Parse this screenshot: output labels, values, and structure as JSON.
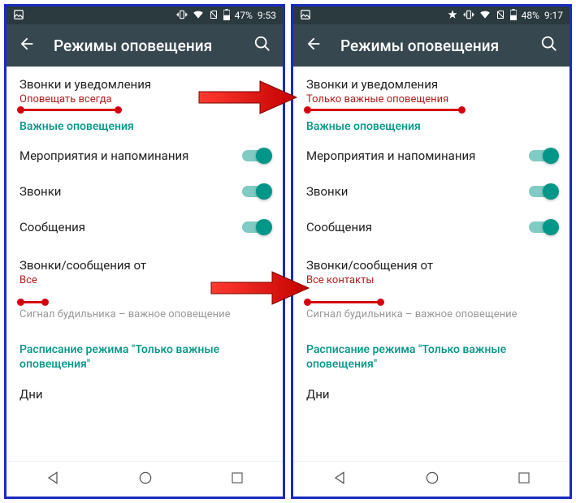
{
  "left": {
    "status": {
      "battery": "47%",
      "time": "9:53"
    },
    "appbar_title": "Режимы оповещения",
    "calls_notif_title": "Звонки и уведомления",
    "calls_notif_sub": "Оповещать всегда",
    "section_priority": "Важные оповещения",
    "events": "Мероприятия и напоминания",
    "calls": "Звонки",
    "messages": "Сообщения",
    "from_title": "Звонки/сообщения от",
    "from_sub": "Все",
    "alarm_hint": "Сигнал будильника – важное оповещение",
    "schedule_section": "Расписание режима \"Только важные оповещения\"",
    "days": "Дни"
  },
  "right": {
    "status": {
      "battery": "48%",
      "time": "9:17"
    },
    "appbar_title": "Режимы оповещения",
    "calls_notif_title": "Звонки и уведомления",
    "calls_notif_sub": "Только важные оповещения",
    "section_priority": "Важные оповещения",
    "events": "Мероприятия и напоминания",
    "calls": "Звонки",
    "messages": "Сообщения",
    "from_title": "Звонки/сообщения от",
    "from_sub": "Все контакты",
    "alarm_hint": "Сигнал будильника – важное оповещение",
    "schedule_section": "Расписание режима \"Только важные оповещения\"",
    "days": "Дни"
  }
}
